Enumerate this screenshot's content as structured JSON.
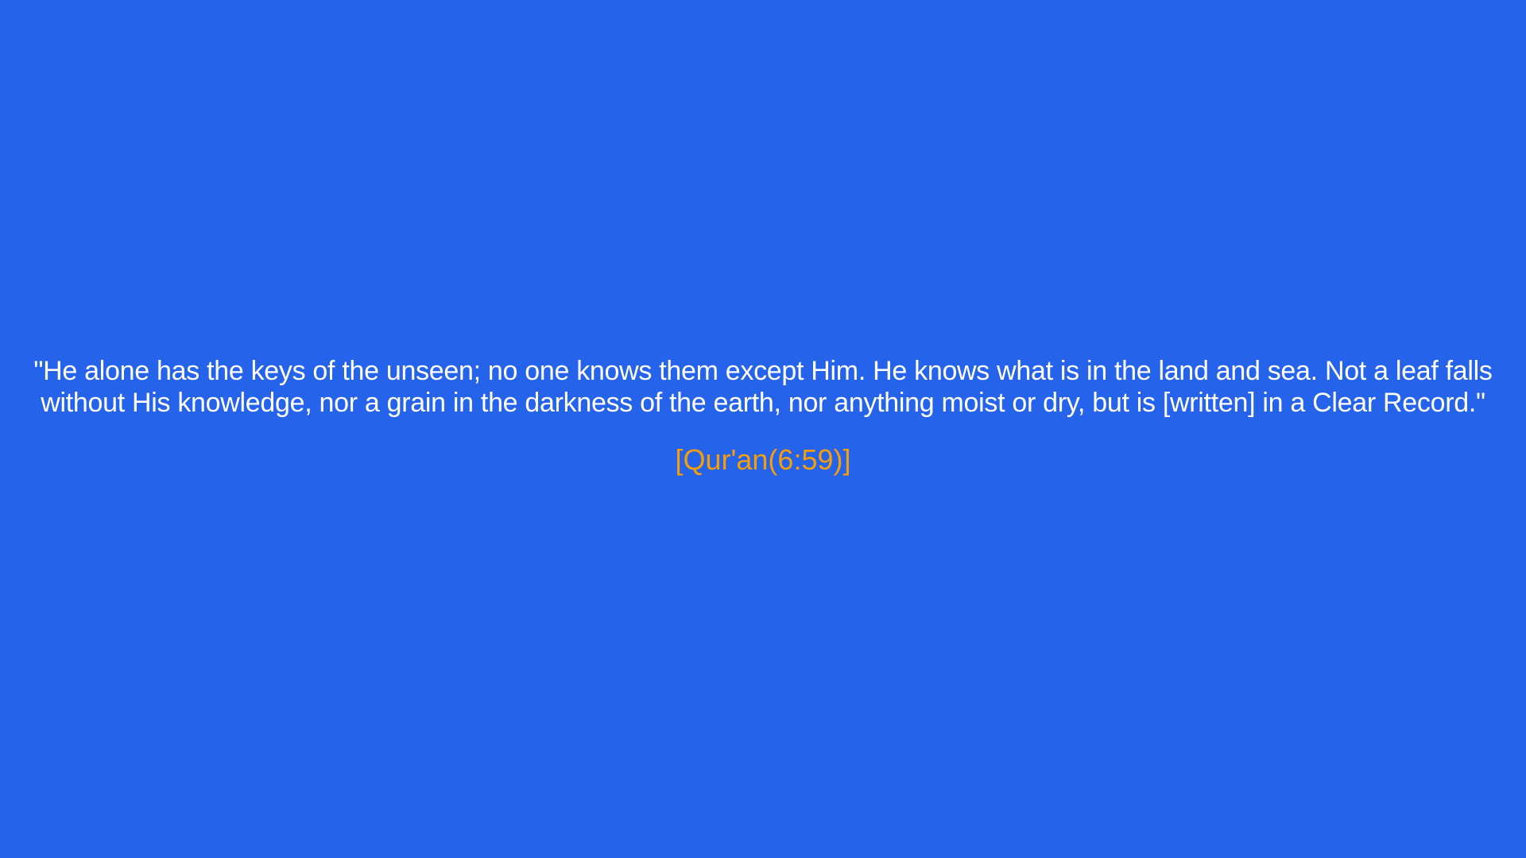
{
  "quote": {
    "text": "\"He alone has the keys of the unseen; no one knows them except Him. He knows what is in the land and sea. Not a leaf falls without His knowledge, nor a grain in the darkness of the earth, nor anything moist or dry, but is [written] in a Clear Record.\"",
    "citation": "[Qur'an(6:59)]"
  },
  "colors": {
    "background": "#2563eb",
    "text": "#ffffff",
    "citation": "#f59e0b"
  }
}
